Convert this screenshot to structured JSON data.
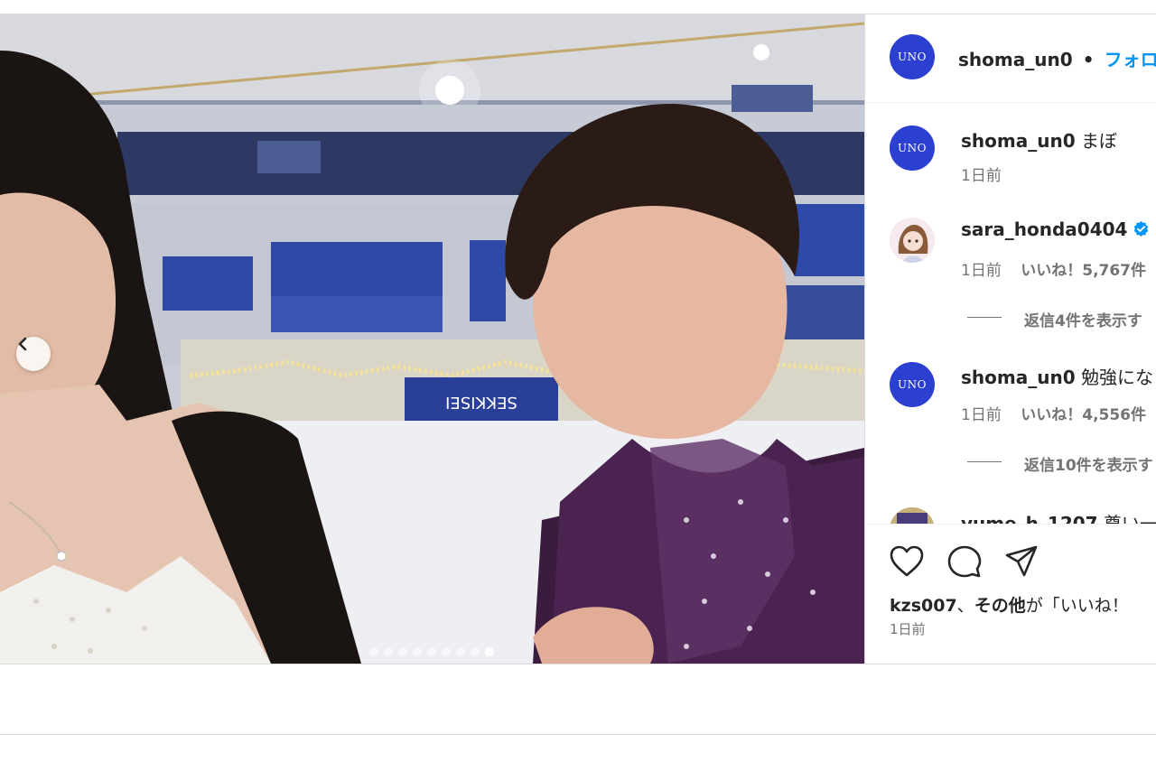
{
  "post": {
    "author": "shoma_un0",
    "separator": "•",
    "follow_label": "フォロ",
    "avatar_text": "UNO",
    "carousel": {
      "slides": 9,
      "active_index": 8
    }
  },
  "comments": [
    {
      "username": "shoma_un0",
      "text": "まぼ",
      "time": "1日前",
      "likes": "",
      "reply": ""
    },
    {
      "username": "sara_honda0404",
      "text": "",
      "verified": true,
      "time": "1日前",
      "likes": "いいね！5,767件",
      "reply": "返信4件を表示す"
    },
    {
      "username": "shoma_un0",
      "text": "勉強にな",
      "time": "1日前",
      "likes": "いいね！4,556件",
      "reply": "返信10件を表示す"
    },
    {
      "username": "yume_h_1207",
      "text": "尊い一",
      "time": "",
      "likes": "",
      "reply": ""
    }
  ],
  "actions": {
    "like_icon": "heart-icon",
    "comment_icon": "comment-icon",
    "share_icon": "send-icon",
    "liked_by_user": "kzs007",
    "liked_by_suffix": "、",
    "liked_by_others": "その他",
    "liked_by_tail": "が「いいね！",
    "time": "1日前"
  },
  "colors": {
    "follow": "#0095f6",
    "avatar_bg": "#2b3fd1",
    "verified": "#0095f6",
    "muted": "#737373"
  }
}
